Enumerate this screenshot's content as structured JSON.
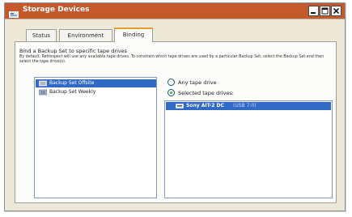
{
  "window": {
    "title": "Storage Devices",
    "title_icon": "storage-icon",
    "controls": [
      "minimize-icon",
      "maximize-icon",
      "close-icon"
    ],
    "titlebar_color": "#c45a2c"
  },
  "tabs": [
    {
      "label": "Status",
      "active": false
    },
    {
      "label": "Environment",
      "active": false
    },
    {
      "label": "Binding",
      "active": true
    }
  ],
  "binding": {
    "heading": "Bind a Backup Set to specific tape drives",
    "description": "By default, Retrospect will use any available tape drives. To constrain which tape drives are used by a particular Backup Set, select the Backup Set and then select the tape drive(s).",
    "backup_sets": [
      {
        "label": "Backup Set Offsite",
        "selected": true,
        "icon": "backup-set-icon"
      },
      {
        "label": "Backup Set Weekly",
        "selected": false,
        "icon": "backup-set-icon"
      }
    ],
    "options": {
      "any_label": "Any tape drive",
      "selected_label": "Selected tape drives:",
      "selected_value": "selected"
    },
    "drives": [
      {
        "name": "Sony AIT-2 DC",
        "connection": "(USB 7:0)",
        "icon": "tape-drive-icon",
        "selected": true
      }
    ]
  },
  "colors": {
    "selection": "#316ac5",
    "active_tab_accent": "#e59b2a",
    "radio_dot": "#3bb33b"
  }
}
